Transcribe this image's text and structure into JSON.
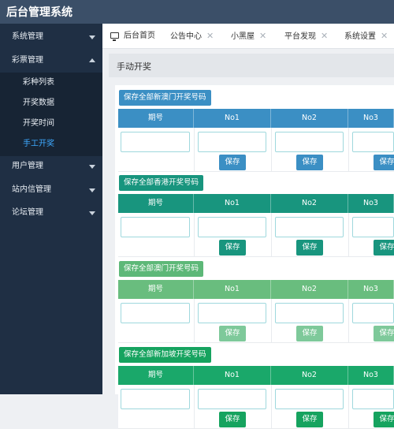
{
  "app": {
    "title": "后台管理系统"
  },
  "sidebar": {
    "items": [
      {
        "label": "系统管理"
      },
      {
        "label": "彩票管理"
      },
      {
        "label": "用户管理"
      },
      {
        "label": "站内信管理"
      },
      {
        "label": "论坛管理"
      }
    ],
    "sub_items": [
      {
        "label": "彩种列表"
      },
      {
        "label": "开奖数据"
      },
      {
        "label": "开奖时间"
      },
      {
        "label": "手工开奖"
      }
    ]
  },
  "tabs": [
    {
      "label": "后台首页"
    },
    {
      "label": "公告中心"
    },
    {
      "label": "小黑屋"
    },
    {
      "label": "平台发现"
    },
    {
      "label": "系统设置"
    }
  ],
  "page": {
    "title": "手动开奖"
  },
  "sections": [
    {
      "button": "保存全部新澳门开奖号码",
      "color": "#3b8fc4"
    },
    {
      "button": "保存全部香港开奖号码",
      "color": "#18957e"
    },
    {
      "button": "保存全部澳门开奖号码",
      "color": "#5db878"
    },
    {
      "button": "保存全部新加坡开奖号码",
      "color": "#16a35f"
    }
  ],
  "table": {
    "headers": [
      "期号",
      "No1",
      "No2",
      "No3"
    ],
    "save_label": "保存"
  }
}
